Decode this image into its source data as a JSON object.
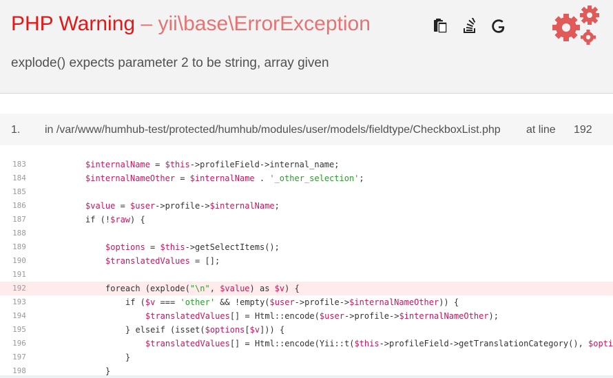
{
  "header": {
    "error_type": "PHP Warning",
    "separator": " – ",
    "exception_class": "yii\\base\\ErrorException",
    "message": "explode() expects parameter 2 to be string, array given"
  },
  "tools": [
    {
      "name": "copy-stacktrace-icon"
    },
    {
      "name": "stackoverflow-icon"
    },
    {
      "name": "google-icon"
    }
  ],
  "callstack": {
    "index": "1.",
    "file": "in /var/www/humhub-test/protected/humhub/modules/user/models/fieldtype/CheckboxList.php",
    "at_line_label": "at line",
    "line": "192"
  },
  "code": {
    "highlight_line": "192",
    "lines": [
      {
        "n": "183",
        "indent": 0
      },
      {
        "n": "184",
        "indent": 0
      },
      {
        "n": "185",
        "indent": 0
      },
      {
        "n": "186",
        "indent": 0
      },
      {
        "n": "187",
        "indent": 0
      },
      {
        "n": "188",
        "indent": 0
      },
      {
        "n": "189",
        "indent": 1
      },
      {
        "n": "190",
        "indent": 1
      },
      {
        "n": "191",
        "indent": 0
      },
      {
        "n": "192",
        "indent": 1
      },
      {
        "n": "193",
        "indent": 2
      },
      {
        "n": "194",
        "indent": 3
      },
      {
        "n": "195",
        "indent": 2
      },
      {
        "n": "196",
        "indent": 3
      },
      {
        "n": "197",
        "indent": 2
      },
      {
        "n": "198",
        "indent": 1
      }
    ]
  }
}
